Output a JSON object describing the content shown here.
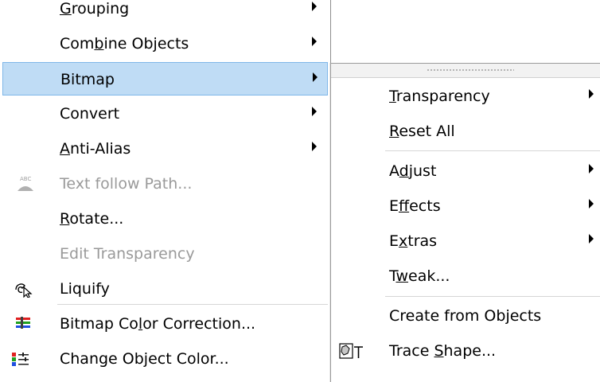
{
  "main_menu": {
    "items": [
      {
        "label": "Grouping",
        "mnemonic_index": 0
      },
      {
        "label": "Combine Objects",
        "mnemonic_index": 3
      },
      {
        "label": "Bitmap"
      },
      {
        "label": "Convert"
      },
      {
        "label": "Anti-Alias",
        "mnemonic_index": 0
      },
      {
        "label": "Text follow Path..."
      },
      {
        "label": "Rotate...",
        "mnemonic_index": 0
      },
      {
        "label": "Edit Transparency"
      },
      {
        "label": "Liquify"
      },
      {
        "label": "Bitmap Color Correction...",
        "mnemonic_index": 9
      },
      {
        "label": "Change Object Color..."
      }
    ]
  },
  "sub_menu": {
    "items": [
      {
        "label": "Transparency",
        "mnemonic_index": 0
      },
      {
        "label": "Reset All",
        "mnemonic_index": 0
      },
      {
        "label": "Adjust",
        "mnemonic_index": 1
      },
      {
        "label": "Effects",
        "mnemonic_index": 1
      },
      {
        "label": "Extras",
        "mnemonic_index": 1
      },
      {
        "label": "Tweak...",
        "mnemonic_index": 1
      },
      {
        "label": "Create from Objects"
      },
      {
        "label": "Trace Shape...",
        "mnemonic_index": 6
      }
    ]
  },
  "colors": {
    "highlight_bg": "#bfdcf5",
    "highlight_border": "#7fb6e8",
    "disabled_text": "#9a9a9a"
  }
}
